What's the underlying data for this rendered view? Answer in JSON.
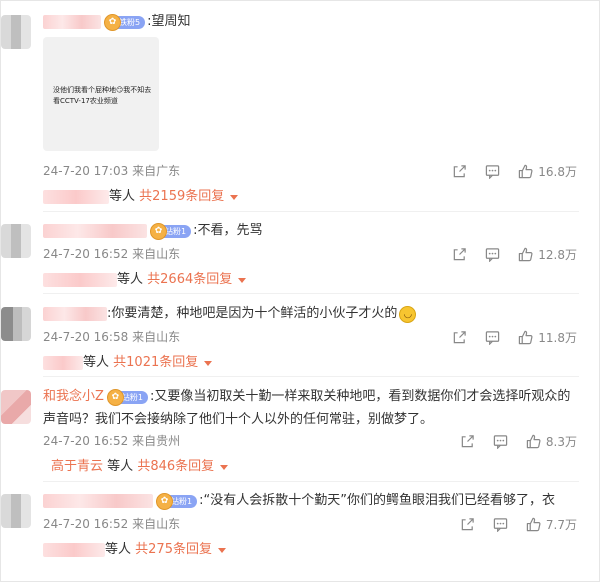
{
  "comments": [
    {
      "name": "",
      "badge": "铁粉5",
      "text": ":望周知",
      "image_text": "没他们我看个屁种地😏我不知去看CCTV-17农业频道",
      "time": "24-7-20 17:03",
      "location": "来自广东",
      "likes": "16.8万",
      "replies_suffix": "等人",
      "replies_name": "",
      "replies_count": "共2159条回复"
    },
    {
      "name": "",
      "badge": "钻粉1",
      "text": ":不看，先骂",
      "time": "24-7-20 16:52",
      "location": "来自山东",
      "likes": "12.8万",
      "replies_suffix": "等人",
      "replies_name": "",
      "replies_count": "共2664条回复"
    },
    {
      "name": "",
      "badge": "",
      "text": ":你要清楚，种地吧是因为十个鲜活的小伙子才火的",
      "time": "24-7-20 16:58",
      "location": "来自山东",
      "likes": "11.8万",
      "replies_suffix": "等人",
      "replies_name": "",
      "replies_count": "共1021条回复"
    },
    {
      "name": "和我念小Z",
      "badge": "钻粉1",
      "text": ":又要像当初取关十勤一样来取关种地吧，看到数据你们才会选择听观众的声音吗？我们不会接纳除了他们十个人以外的任何常驻，别做梦了。",
      "time": "24-7-20 16:52",
      "location": "来自贵州",
      "likes": "8.3万",
      "replies_suffix": "等人",
      "replies_name": "高于青云",
      "replies_count": "共846条回复"
    },
    {
      "name": "",
      "badge": "钻粉1",
      "text": ":“没有人会拆散十个勤天”你们的鳄鱼眼泪我们已经看够了，衣",
      "time": "24-7-20 16:52",
      "location": "来自山东",
      "likes": "7.7万",
      "replies_suffix": "等人",
      "replies_name": "",
      "replies_count": "共275条回复"
    }
  ],
  "icons": {
    "share": "share-icon",
    "comment": "comment-icon",
    "like": "thumbs-up-icon",
    "emoji": "smile-emoji-icon",
    "badge": "fan-badge-icon"
  },
  "colors": {
    "accent": "#eb7350",
    "meta_gray": "#888888",
    "badge_blue": "#8aa4f4"
  }
}
